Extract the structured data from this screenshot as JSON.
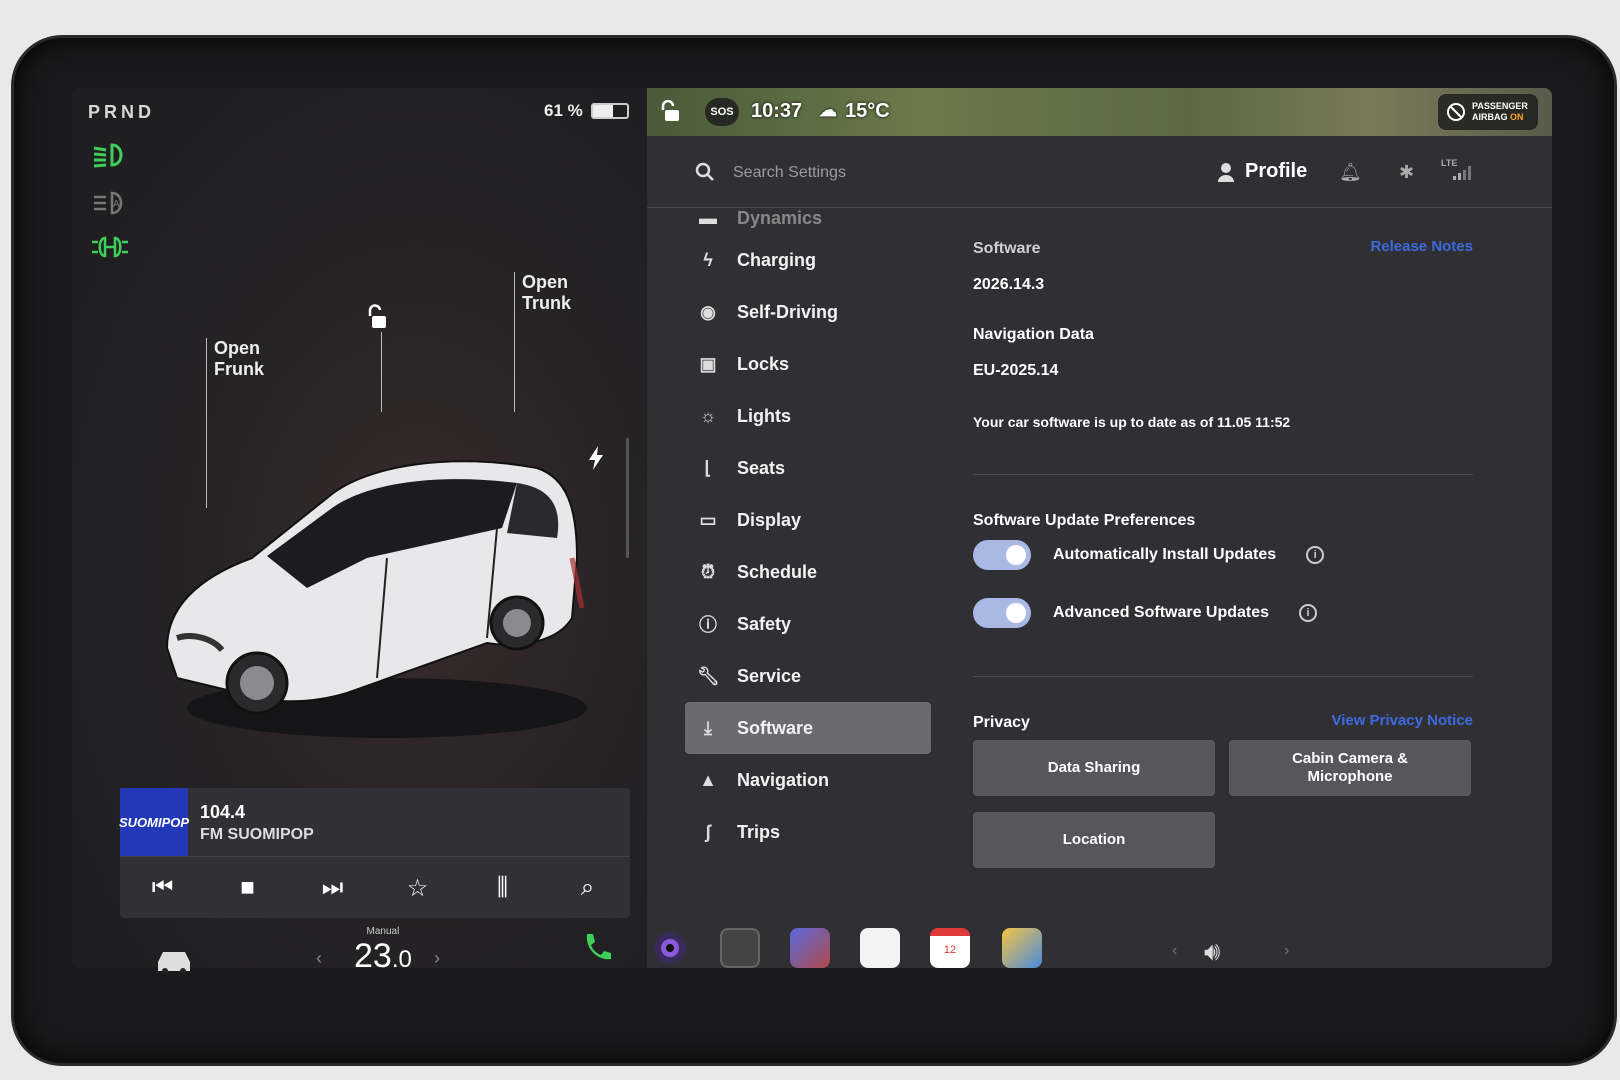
{
  "left": {
    "gear": "PRND",
    "battery_pct": "61 %",
    "battery_level": 0.61,
    "frunk_label_1": "Open",
    "frunk_label_2": "Frunk",
    "trunk_label_1": "Open",
    "trunk_label_2": "Trunk"
  },
  "media": {
    "logo_text": "SUOMIPOP",
    "frequency": "104.4",
    "station": "FM SUOMIPOP",
    "controls": [
      "prev-icon",
      "stop-icon",
      "next-icon",
      "favorite-icon",
      "equalizer-icon",
      "search-icon"
    ]
  },
  "status": {
    "sos": "SOS",
    "time": "10:37",
    "temperature": "15°C",
    "airbag_line1": "PASSENGER",
    "airbag_line2": "AIRBAG",
    "airbag_state": "ON"
  },
  "search": {
    "placeholder": "Search Settings"
  },
  "header": {
    "profile": "Profile",
    "network": "LTE"
  },
  "menu": {
    "items": [
      {
        "label": "Dynamics",
        "icon": "car-icon"
      },
      {
        "label": "Charging",
        "icon": "bolt-icon"
      },
      {
        "label": "Self-Driving",
        "icon": "steering-wheel-icon"
      },
      {
        "label": "Locks",
        "icon": "lock-icon"
      },
      {
        "label": "Lights",
        "icon": "sun-icon"
      },
      {
        "label": "Seats",
        "icon": "seat-icon"
      },
      {
        "label": "Display",
        "icon": "display-icon"
      },
      {
        "label": "Schedule",
        "icon": "alarm-icon"
      },
      {
        "label": "Safety",
        "icon": "alert-icon"
      },
      {
        "label": "Service",
        "icon": "wrench-icon"
      },
      {
        "label": "Software",
        "icon": "download-icon"
      },
      {
        "label": "Navigation",
        "icon": "navigation-icon"
      },
      {
        "label": "Trips",
        "icon": "trips-icon"
      }
    ],
    "active": "Software"
  },
  "software": {
    "title": "Software",
    "release_notes": "Release Notes",
    "version": "2026.14.3",
    "nav_title": "Navigation Data",
    "nav_version": "EU-2025.14",
    "status_text": "Your car software is up to date as of 11.05 11:52",
    "prefs_title": "Software Update Preferences",
    "toggle1": "Automatically Install Updates",
    "toggle2": "Advanced Software Updates",
    "privacy_title": "Privacy",
    "privacy_link": "View Privacy Notice",
    "btn_data_sharing": "Data Sharing",
    "btn_cabin_1": "Cabin Camera &",
    "btn_cabin_2": "Microphone",
    "btn_location": "Location"
  },
  "dock": {
    "climate_mode": "Manual",
    "climate_temp_int": "23",
    "climate_temp_dec": ".0",
    "calendar_day": "12"
  },
  "colors": {
    "accent": "#3e6ae1",
    "light_green": "#3ecf5a"
  }
}
